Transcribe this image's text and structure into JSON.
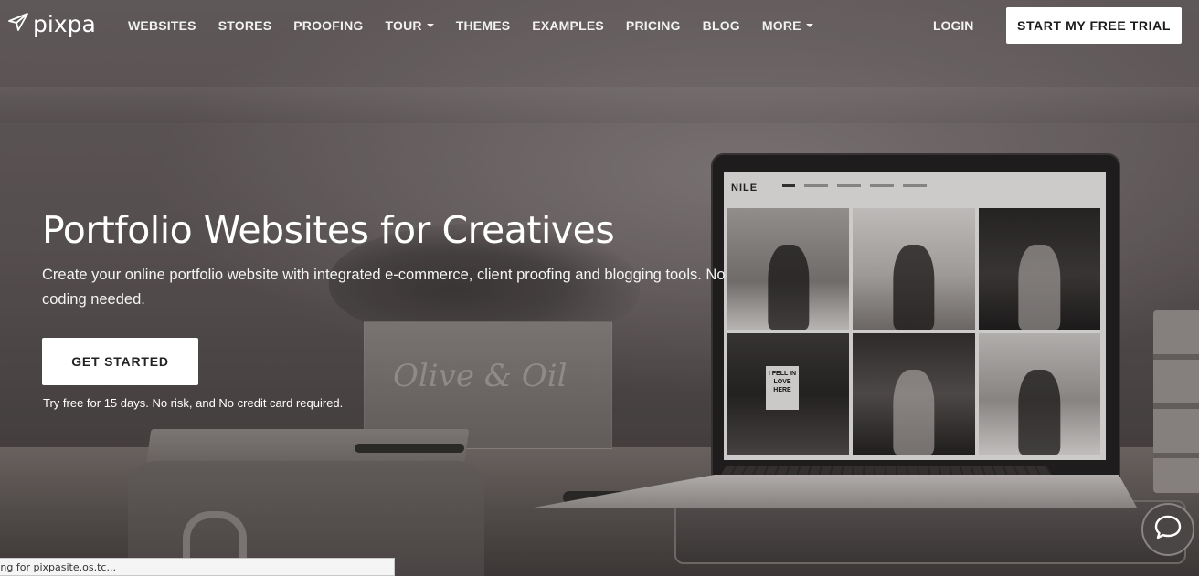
{
  "nav": {
    "logo_text": "pixpa",
    "links": [
      {
        "label": "WEBSITES",
        "dropdown": false
      },
      {
        "label": "STORES",
        "dropdown": false
      },
      {
        "label": "PROOFING",
        "dropdown": false
      },
      {
        "label": "TOUR",
        "dropdown": true
      },
      {
        "label": "THEMES",
        "dropdown": false
      },
      {
        "label": "EXAMPLES",
        "dropdown": false
      },
      {
        "label": "PRICING",
        "dropdown": false
      },
      {
        "label": "BLOG",
        "dropdown": false
      },
      {
        "label": "MORE",
        "dropdown": true
      }
    ],
    "login_label": "LOGIN",
    "trial_label": "START MY FREE TRIAL"
  },
  "hero": {
    "title": "Portfolio Websites for Creatives",
    "subtitle": "Create your online portfolio website with integrated e-commerce, client proofing and blogging tools. No coding needed.",
    "cta_label": "GET STARTED",
    "cta_note": "Try free for 15 days. No risk, and No credit card required."
  },
  "laptop_screen": {
    "site_logo": "NILE",
    "sign_text": "I FELL IN LOVE HERE"
  },
  "background": {
    "planter_text": "Olive & Oil"
  },
  "status_bar": {
    "text": "iting for pixpasite.os.tc..."
  },
  "icons": {
    "logo": "paper-plane-icon",
    "chat": "chat-bubble-icon",
    "caret": "caret-down-icon"
  },
  "colors": {
    "cta_background": "#ffffff",
    "cta_text": "#222222",
    "nav_text": "#f2f2f2"
  }
}
